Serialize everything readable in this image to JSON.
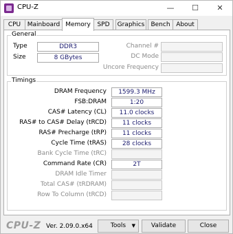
{
  "window": {
    "title": "CPU-Z",
    "minimize": "—",
    "maximize": "☐",
    "close": "✕"
  },
  "tabs": [
    {
      "label": "CPU"
    },
    {
      "label": "Mainboard"
    },
    {
      "label": "Memory",
      "active": true
    },
    {
      "label": "SPD"
    },
    {
      "label": "Graphics"
    },
    {
      "label": "Bench"
    },
    {
      "label": "About"
    }
  ],
  "general": {
    "title": "General",
    "type_label": "Type",
    "type_value": "DDR3",
    "size_label": "Size",
    "size_value": "8 GBytes",
    "channel_label": "Channel #",
    "channel_value": "",
    "dc_mode_label": "DC Mode",
    "dc_mode_value": "",
    "uncore_label": "Uncore Frequency",
    "uncore_value": ""
  },
  "timings": {
    "title": "Timings",
    "rows": [
      {
        "label": "DRAM Frequency",
        "value": "1599.3 MHz",
        "enabled": true
      },
      {
        "label": "FSB:DRAM",
        "value": "1:20",
        "enabled": true
      },
      {
        "label": "CAS# Latency (CL)",
        "value": "11.0 clocks",
        "enabled": true
      },
      {
        "label": "RAS# to CAS# Delay (tRCD)",
        "value": "11 clocks",
        "enabled": true
      },
      {
        "label": "RAS# Precharge (tRP)",
        "value": "11 clocks",
        "enabled": true
      },
      {
        "label": "Cycle Time (tRAS)",
        "value": "28 clocks",
        "enabled": true
      },
      {
        "label": "Bank Cycle Time (tRC)",
        "value": "",
        "enabled": false
      },
      {
        "label": "Command Rate (CR)",
        "value": "2T",
        "enabled": true
      },
      {
        "label": "DRAM Idle Timer",
        "value": "",
        "enabled": false
      },
      {
        "label": "Total CAS# (tRDRAM)",
        "value": "",
        "enabled": false
      },
      {
        "label": "Row To Column (tRCD)",
        "value": "",
        "enabled": false
      }
    ]
  },
  "footer": {
    "logo": "CPU-Z",
    "version": "Ver. 2.09.0.x64",
    "tools_label": "Tools",
    "tools_arrow": "▼",
    "validate_label": "Validate",
    "close_label": "Close"
  }
}
